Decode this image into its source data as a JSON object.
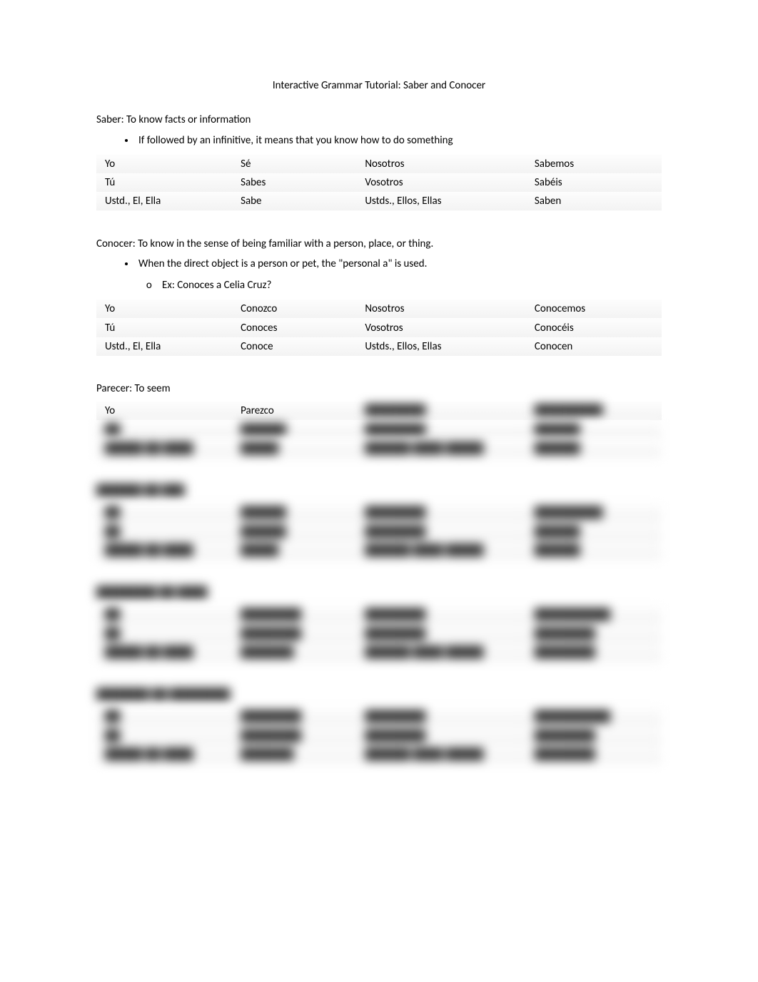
{
  "title": "Interactive Grammar Tutorial: Saber and Conocer",
  "saber": {
    "heading": "Saber: To know facts or information",
    "bullet": "If followed by an infinitive, it means that you know how to do something",
    "rows": [
      {
        "p1": "Yo",
        "f1": "Sé",
        "p2": "Nosotros",
        "f2": "Sabemos"
      },
      {
        "p1": "Tú",
        "f1": "Sabes",
        "p2": "Vosotros",
        "f2": "Sabéis"
      },
      {
        "p1": "Ustd., El, Ella",
        "f1": "Sabe",
        "p2": "Ustds., Ellos, Ellas",
        "f2": "Saben"
      }
    ]
  },
  "conocer": {
    "heading": "Conocer: To know in the sense of being familiar with a person, place, or thing.",
    "bullet": "When the direct object is a person or pet, the \"personal a\" is used.",
    "sub": "Ex: Conoces a Celia Cruz?",
    "rows": [
      {
        "p1": "Yo",
        "f1": "Conozco",
        "p2": "Nosotros",
        "f2": "Conocemos"
      },
      {
        "p1": "Tú",
        "f1": "Conoces",
        "p2": "Vosotros",
        "f2": "Conocéis"
      },
      {
        "p1": "Ustd., El, Ella",
        "f1": "Conoce",
        "p2": "Ustds., Ellos, Ellas",
        "f2": "Conocen"
      }
    ]
  },
  "parecer": {
    "heading": "Parecer: To seem",
    "rows": [
      {
        "p1": "Yo",
        "f1": "Parezco",
        "p2": "",
        "f2": ""
      },
      {
        "p1": "",
        "f1": "",
        "p2": "",
        "f2": ""
      },
      {
        "p1": "",
        "f1": "",
        "p2": "",
        "f2": ""
      }
    ]
  },
  "hidden": [
    {
      "heading": "██████ ██ ███",
      "rows": [
        {
          "p1": "██",
          "f1": "██████",
          "p2": "████████",
          "f2": "█████████"
        },
        {
          "p1": "██",
          "f1": "██████",
          "p2": "████████",
          "f2": "██████"
        },
        {
          "p1": "█████ ██ ████",
          "f1": "█████",
          "p2": "██████ ████ █████",
          "f2": "██████"
        }
      ]
    },
    {
      "heading": "████████ ██ ████",
      "rows": [
        {
          "p1": "██",
          "f1": "████████",
          "p2": "████████",
          "f2": "██████████"
        },
        {
          "p1": "██",
          "f1": "████████",
          "p2": "████████",
          "f2": "████████"
        },
        {
          "p1": "█████ ██ ████",
          "f1": "███████",
          "p2": "██████ ████ █████",
          "f2": "████████"
        }
      ]
    },
    {
      "heading": "███████ ██ ████████",
      "rows": [
        {
          "p1": "██",
          "f1": "████████",
          "p2": "████████",
          "f2": "██████████"
        },
        {
          "p1": "██",
          "f1": "████████",
          "p2": "████████",
          "f2": "████████"
        },
        {
          "p1": "█████ ██ ████",
          "f1": "███████",
          "p2": "██████ ████ █████",
          "f2": "████████"
        }
      ]
    }
  ]
}
